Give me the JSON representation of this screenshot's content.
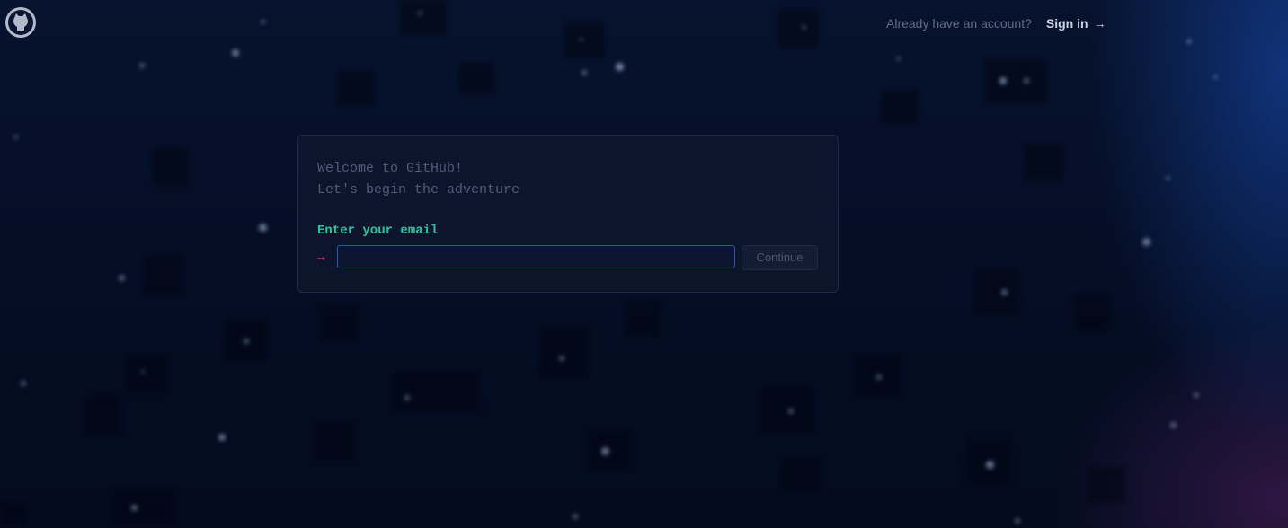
{
  "header": {
    "logo_icon": "github-mark-icon",
    "account_prompt": "Already have an account?",
    "signin_label": "Sign in",
    "signin_icon": "arrow-right-icon"
  },
  "card": {
    "welcome_line1": "Welcome to GitHub!",
    "welcome_line2": "Let's begin the adventure",
    "prompt_label": "Enter your email",
    "prompt_icon": "arrow-right-icon",
    "email_value": "",
    "email_placeholder": "",
    "continue_label": "Continue"
  },
  "colors": {
    "background": "#040d21",
    "prompt_label": "#2fc2a0",
    "prompt_arrow": "#e0357a",
    "input_border": "#2958b8"
  }
}
